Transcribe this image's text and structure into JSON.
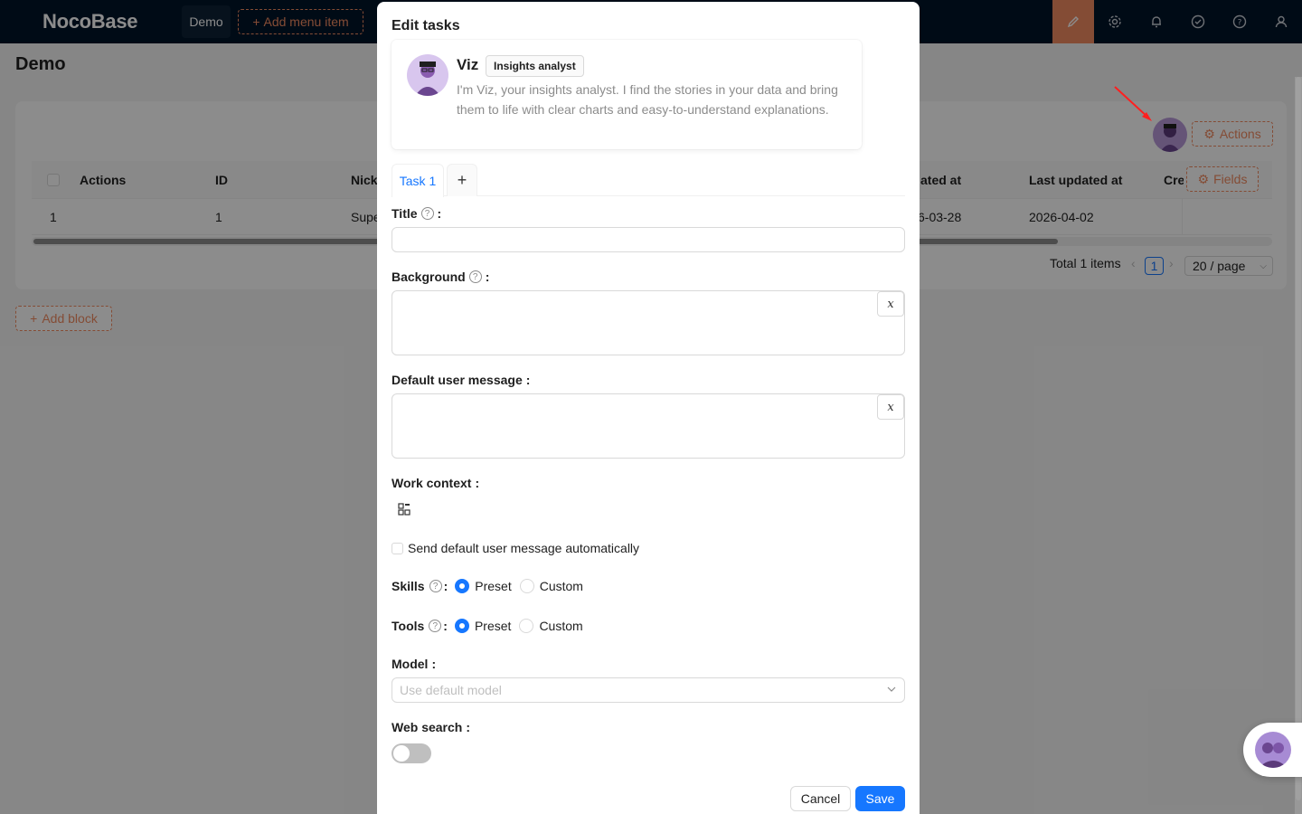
{
  "app": {
    "logo": "NocoBase"
  },
  "nav": {
    "demo": "Demo",
    "add_menu_item": "Add menu item"
  },
  "page": {
    "title": "Demo",
    "add_block": "Add block"
  },
  "toolbar": {
    "actions": "Actions",
    "fields": "Fields"
  },
  "table": {
    "headers": {
      "actions": "Actions",
      "id": "ID",
      "nick": "Nick",
      "created_at": "ated at",
      "last_updated_at": "Last updated at",
      "cre": "Cre"
    },
    "row": {
      "actions": "1",
      "id": "1",
      "nick": "Supe",
      "created_at": "6-03-28",
      "last_updated_at": "2026-04-02"
    }
  },
  "pagination": {
    "total": "Total 1 items",
    "current": "1",
    "page_size": "20 / page"
  },
  "modal": {
    "title": "Edit tasks",
    "agent": {
      "name": "Viz",
      "tag": "Insights analyst",
      "description": "I'm Viz, your insights analyst. I find the stories in your data and bring them to life with clear charts and easy-to-understand explanations."
    },
    "tabs": [
      {
        "label": "Task 1"
      }
    ],
    "fields": {
      "title": {
        "label": "Title",
        "value": ""
      },
      "background": {
        "label": "Background",
        "value": ""
      },
      "default_user_message": {
        "label": "Default user message",
        "value": ""
      },
      "work_context": {
        "label": "Work context"
      },
      "send_auto": {
        "label": "Send default user message automatically",
        "checked": false
      },
      "skills": {
        "label": "Skills",
        "options": [
          "Preset",
          "Custom"
        ],
        "selected": "Preset"
      },
      "tools": {
        "label": "Tools",
        "options": [
          "Preset",
          "Custom"
        ],
        "selected": "Preset"
      },
      "model": {
        "label": "Model",
        "placeholder": "Use default model"
      },
      "web_search": {
        "label": "Web search",
        "enabled": false
      }
    },
    "buttons": {
      "cancel": "Cancel",
      "save": "Save"
    }
  },
  "colors": {
    "brand": "#f18b62",
    "primary": "#1677ff",
    "header_bg": "#001529"
  }
}
